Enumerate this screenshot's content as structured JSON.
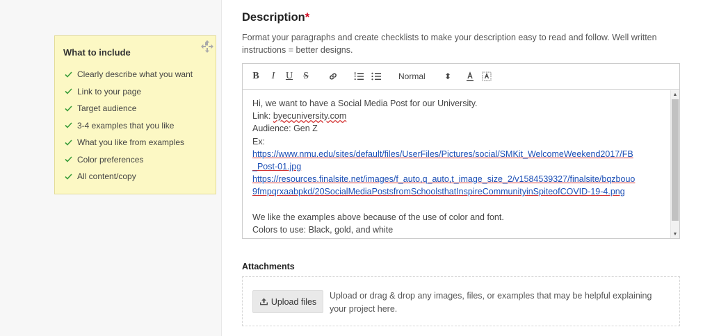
{
  "tips": {
    "title": "What to include",
    "items": [
      "Clearly describe what you want",
      "Link to your page",
      "Target audience",
      "3-4 examples that you like",
      "What you like from examples",
      "Color preferences",
      "All content/copy"
    ]
  },
  "description": {
    "title": "Description",
    "required_mark": "*",
    "help": "Format your paragraphs and create checklists to make your description easy to read and follow. Well written instructions = better designs.",
    "toolbar": {
      "bold": "B",
      "italic": "I",
      "underline": "U",
      "strike": "S",
      "format_value": "Normal",
      "format_arrows": "⬍"
    },
    "body": {
      "line1": "Hi, we want to have a Social Media Post for our University.",
      "link_label": "Link: ",
      "link_value": "byecuniversity.com",
      "audience": "Audience: Gen Z",
      "ex": "Ex:",
      "url1_a": "https://www.nmu.edu/sites/default/files/UserFiles/Pictures/social/SMKit_WelcomeWeekend2017/FB",
      "url1_b": "_Post-01.jpg",
      "url2_a": "https://resources.finalsite.net/images/f_auto,q_auto,t_image_size_2/v1584539327/finalsite/bqzbouo",
      "url2_b": "9fmpqrxaabpkd/20SocialMediaPostsfromSchoolsthatInspireCommunityinSpiteofCOVID-19-4.png",
      "reason": "We like the examples above because of the use of color and font.",
      "colors": "Colors to use: Black, gold, and white"
    }
  },
  "attachments": {
    "title": "Attachments",
    "upload_label": "Upload files",
    "help": "Upload or drag & drop any images, files, or examples that may be helpful explaining your project here."
  },
  "colors": {
    "required": "#d0021b",
    "tips_bg": "#fcf8c4",
    "check": "#3a9d3a",
    "link": "#1c4fb5"
  },
  "icons": [
    "move-icon",
    "check-icon",
    "link-icon",
    "ordered-list-icon",
    "bullet-list-icon",
    "text-color-icon",
    "background-color-icon",
    "upload-icon"
  ]
}
